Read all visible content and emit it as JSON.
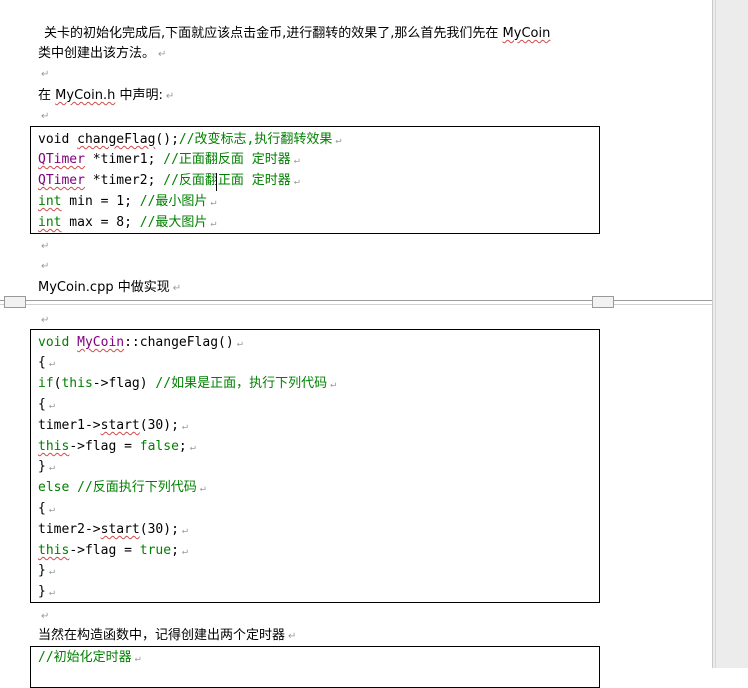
{
  "doc": {
    "intro_line1": "关卡的初始化完成后,下面就应该点击金币,进行翻转的效果了,那么首先我们先在",
    "intro_mycoin": "MyCoin",
    "intro_line2": "类中创建出该方法。",
    "header_decl_prefix": "在",
    "header_decl_file": "MyCoin.h",
    "header_decl_suffix": "中声明:",
    "cpp_heading": "MyCoin.cpp 中做实现",
    "closing_text": "当然在构造函数中，记得创建出两个定时器",
    "paragraph_mark": "↵",
    "code1": [
      "void changeFlag();//改变标志,执行翻转效果",
      "    QTimer *timer1; //正面翻反面 定时器",
      "    QTimer *timer2; //反面翻正面 定时器",
      "    int min = 1; //最小图片",
      "    int max = 8; //最大图片"
    ],
    "code2": [
      "void MyCoin::changeFlag()",
      "{",
      "    if(this->flag) //如果是正面，执行下列代码",
      "    {",
      "        timer1->start(30);",
      "        this->flag = false;",
      "    }",
      "    else //反面执行下列代码",
      "    {",
      "        timer2->start(30);",
      "        this->flag = true;",
      "    }",
      "}"
    ],
    "code3_first": "//初始化定时器"
  }
}
